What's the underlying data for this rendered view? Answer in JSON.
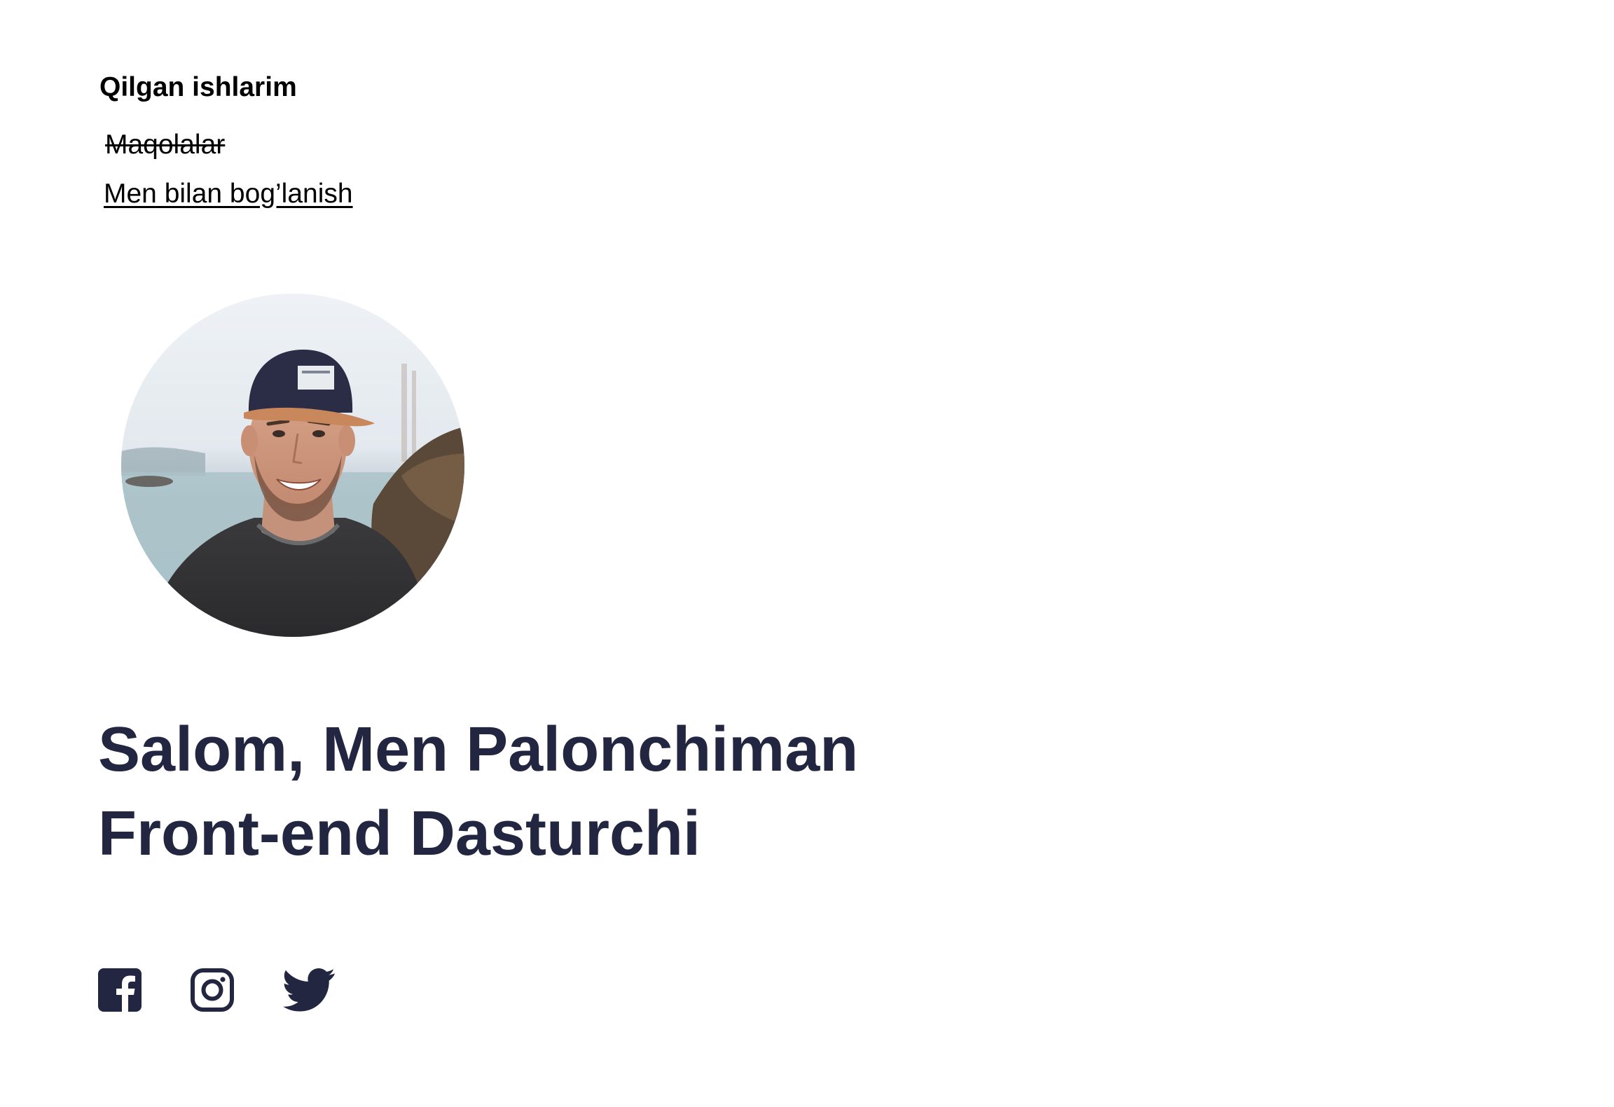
{
  "nav": {
    "title": "Qilgan ishlarim",
    "articles_label": "Maqolalar",
    "contact_label": "Men bilan bog’lanish"
  },
  "hero": {
    "line1": "Salom, Men Palonchiman",
    "line2": "Front-end Dasturchi"
  },
  "socials": [
    {
      "icon": "facebook-icon"
    },
    {
      "icon": "instagram-icon"
    },
    {
      "icon": "twitter-icon"
    }
  ],
  "colors": {
    "heading": "#232641",
    "icon": "#232641"
  }
}
